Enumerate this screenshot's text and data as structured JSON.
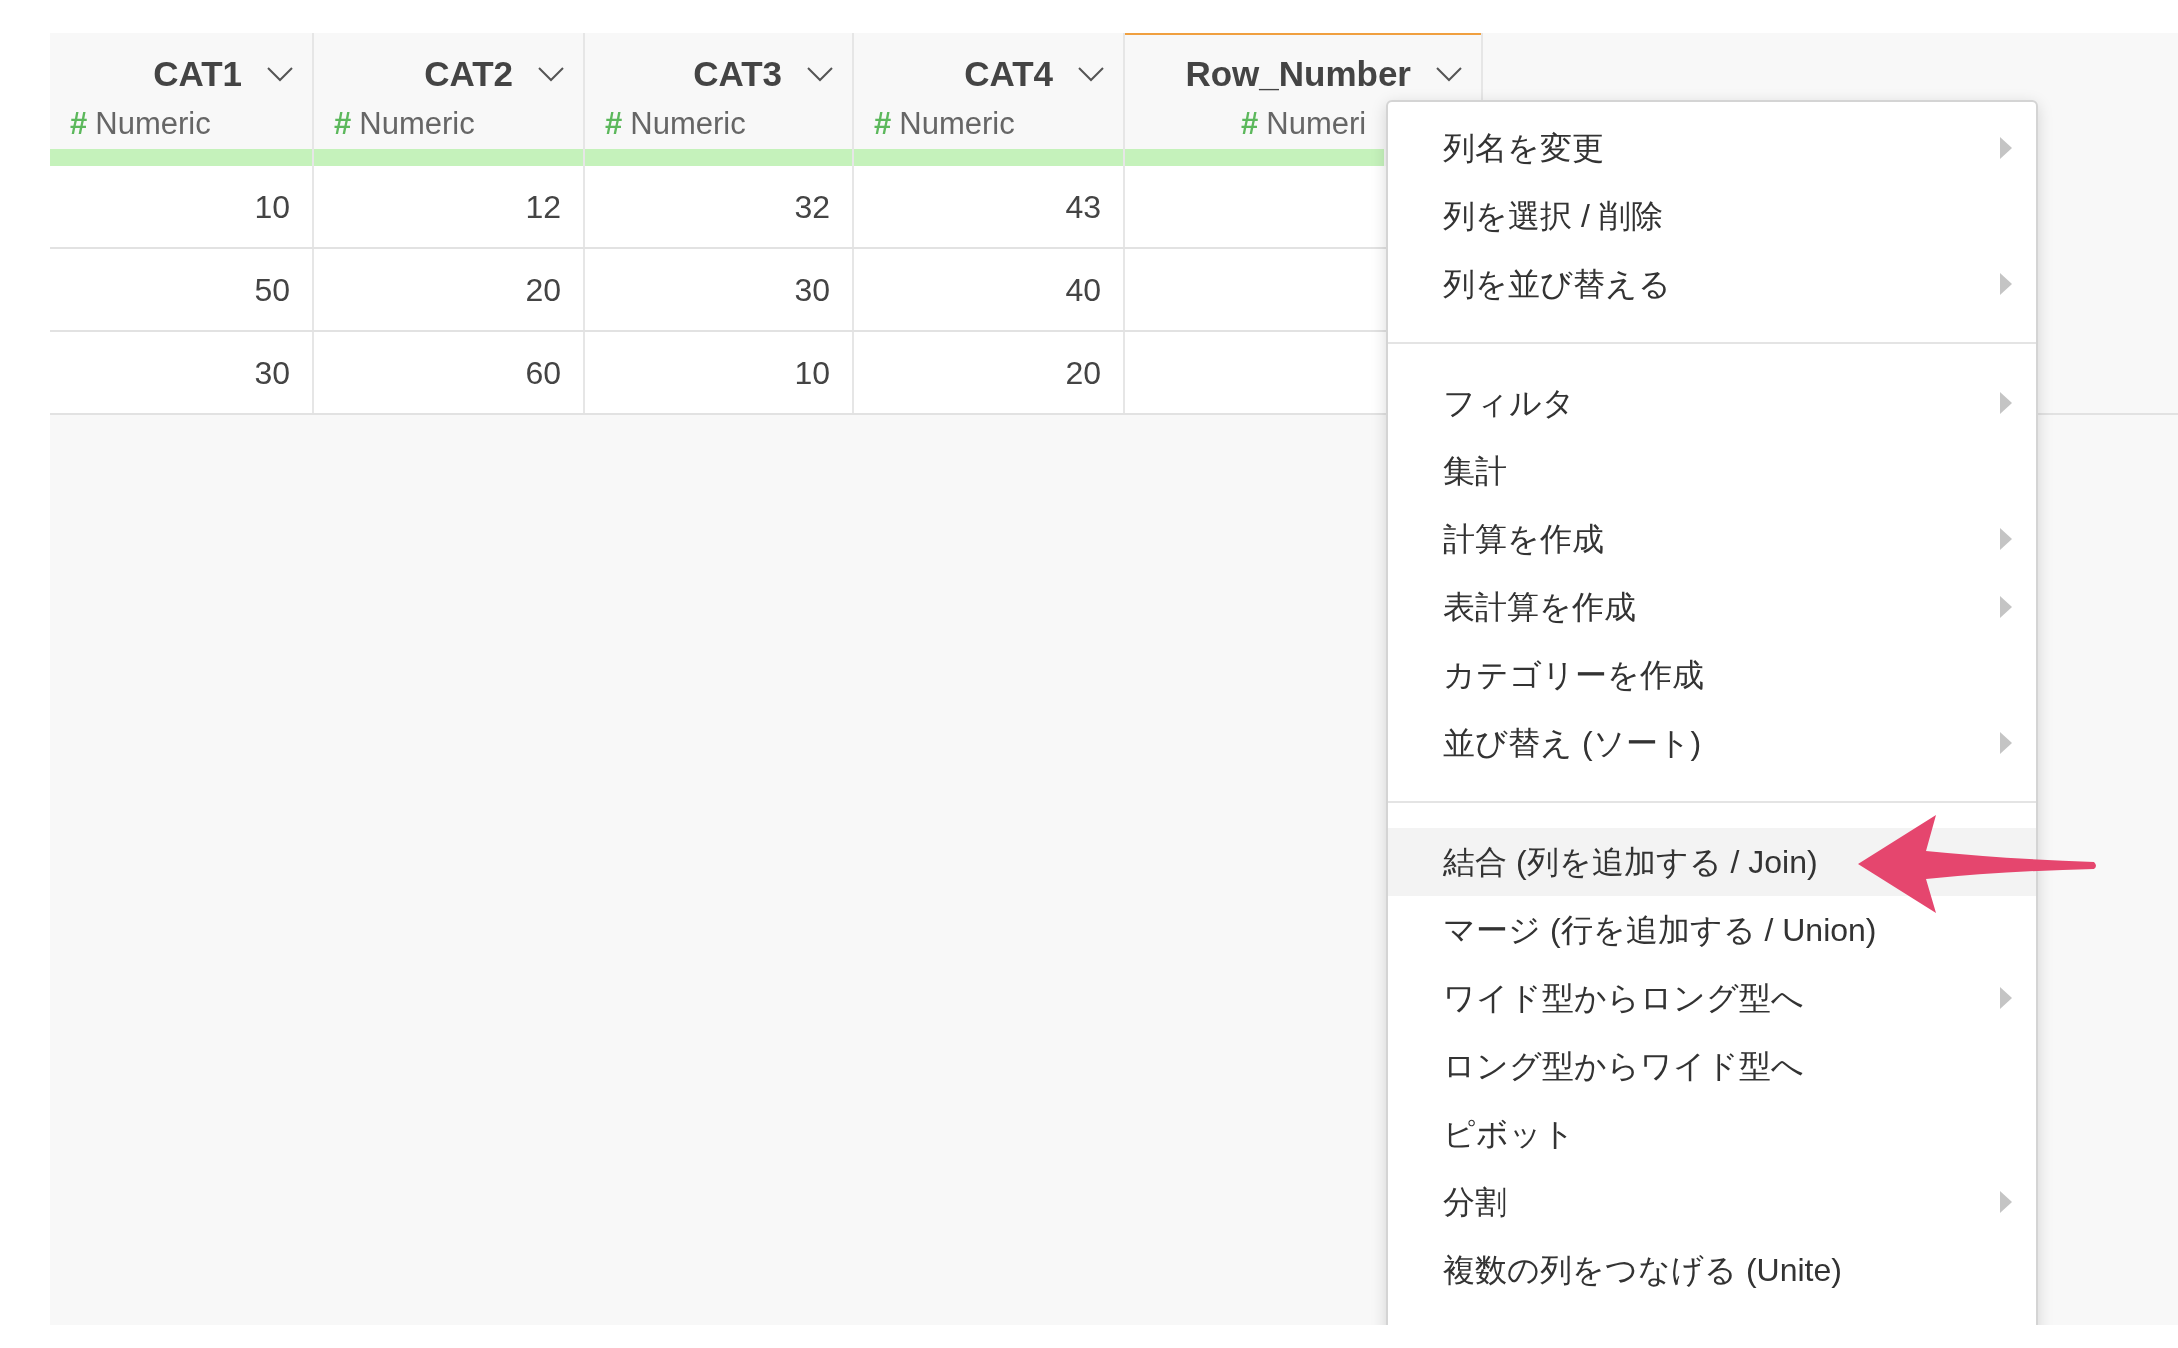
{
  "columns": [
    {
      "name": "CAT1",
      "type_icon": "#",
      "type": "Numeric",
      "selected": false
    },
    {
      "name": "CAT2",
      "type_icon": "#",
      "type": "Numeric",
      "selected": false
    },
    {
      "name": "CAT3",
      "type_icon": "#",
      "type": "Numeric",
      "selected": false
    },
    {
      "name": "CAT4",
      "type_icon": "#",
      "type": "Numeric",
      "selected": false
    },
    {
      "name": "Row_Number",
      "type_icon": "#",
      "type": "Numeri",
      "selected": true
    }
  ],
  "rows": [
    [
      "10",
      "12",
      "32",
      "43"
    ],
    [
      "50",
      "20",
      "30",
      "40"
    ],
    [
      "30",
      "60",
      "10",
      "20"
    ]
  ],
  "context_menu": {
    "groups": [
      [
        {
          "label": "列名を変更",
          "submenu": true,
          "highlighted": false
        },
        {
          "label": "列を選択 / 削除",
          "submenu": false,
          "highlighted": false
        },
        {
          "label": "列を並び替える",
          "submenu": true,
          "highlighted": false
        }
      ],
      [
        {
          "label": "フィルタ",
          "submenu": true,
          "highlighted": false
        },
        {
          "label": "集計",
          "submenu": false,
          "highlighted": false
        },
        {
          "label": "計算を作成",
          "submenu": true,
          "highlighted": false
        },
        {
          "label": "表計算を作成",
          "submenu": true,
          "highlighted": false
        },
        {
          "label": "カテゴリーを作成",
          "submenu": false,
          "highlighted": false
        },
        {
          "label": "並び替え (ソート)",
          "submenu": true,
          "highlighted": false
        }
      ],
      [
        {
          "label": "結合 (列を追加する / Join)",
          "submenu": false,
          "highlighted": true
        },
        {
          "label": "マージ (行を追加する / Union)",
          "submenu": false,
          "highlighted": false
        },
        {
          "label": "ワイド型からロング型へ",
          "submenu": true,
          "highlighted": false
        },
        {
          "label": "ロング型からワイド型へ",
          "submenu": false,
          "highlighted": false
        },
        {
          "label": "ピボット",
          "submenu": false,
          "highlighted": false
        },
        {
          "label": "分割",
          "submenu": true,
          "highlighted": false
        },
        {
          "label": "複数の列をつなげる (Unite)",
          "submenu": false,
          "highlighted": false
        }
      ]
    ]
  }
}
